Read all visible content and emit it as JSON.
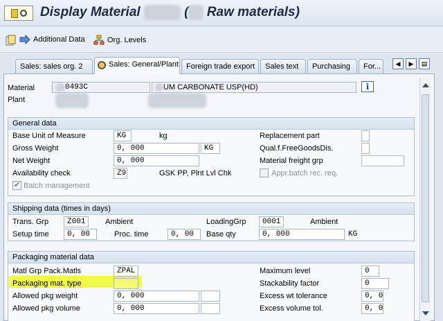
{
  "window": {
    "title_start": "Display Material",
    "title_end": "Raw materials)"
  },
  "toolbar": {
    "additional_data_label": "Additional Data",
    "org_levels_label": "Org. Levels"
  },
  "tabs": [
    {
      "label": "Sales: sales org. 2",
      "active": false
    },
    {
      "label": "Sales: General/Plant",
      "active": true
    },
    {
      "label": "Foreign trade export",
      "active": false
    },
    {
      "label": "Sales text",
      "active": false
    },
    {
      "label": "Purchasing",
      "active": false
    },
    {
      "label": "For...",
      "active": false
    }
  ],
  "header": {
    "material_label": "Material",
    "material_value_suffix": "0493C",
    "material_desc_suffix": "UM CARBONATE USP(HD)",
    "plant_label": "Plant"
  },
  "general": {
    "title": "General data",
    "base_uom_label": "Base Unit of Measure",
    "base_uom_value": "KG",
    "base_uom_text": "kg",
    "gross_weight_label": "Gross Weight",
    "gross_weight_value": "0, 000",
    "weight_unit": "KG",
    "net_weight_label": "Net Weight",
    "net_weight_value": "0, 000",
    "availability_label": "Availability check",
    "availability_value": "Z9",
    "availability_text": "GSK PP, Plnt Lvl Chk",
    "batch_mgmt_label": "Batch management",
    "replacement_label": "Replacement part",
    "qual_free_label": "Qual.f.FreeGoodsDis.",
    "freight_grp_label": "Material freight grp",
    "appr_batch_label": "Appr.batch rec. req."
  },
  "shipping": {
    "title": "Shipping data (times in days)",
    "trans_grp_label": "Trans. Grp",
    "trans_grp_value": "Z001",
    "trans_grp_text": "Ambient",
    "loading_grp_label": "LoadingGrp",
    "loading_grp_value": "0001",
    "loading_grp_text": "Ambient",
    "setup_label": "Setup time",
    "setup_value": "0, 00",
    "proc_label": "Proc. time",
    "proc_value": "0, 00",
    "base_qty_label": "Base qty",
    "base_qty_value": "0, 000",
    "base_qty_unit": "KG"
  },
  "packaging": {
    "title": "Packaging material data",
    "matl_grp_label": "Matl Grp Pack.Matls",
    "matl_grp_value": "ZPAL",
    "pkg_type_label": "Packaging mat. type",
    "allowed_weight_label": "Allowed pkg weight",
    "allowed_weight_value": "0, 000",
    "allowed_volume_label": "Allowed pkg volume",
    "allowed_volume_value": "0, 000",
    "max_level_label": "Maximum level",
    "max_level_value": "0",
    "stack_label": "Stackability factor",
    "stack_value": "0",
    "excess_wt_label": "Excess wt tolerance",
    "excess_wt_value": "0, 0",
    "excess_vol_label": "Excess volume tol.",
    "excess_vol_value": "0, 0"
  },
  "colors": {
    "highlight": "#f0fa28",
    "panel_bg": "#f4f6f9",
    "group_head": "#d6e1ee"
  }
}
